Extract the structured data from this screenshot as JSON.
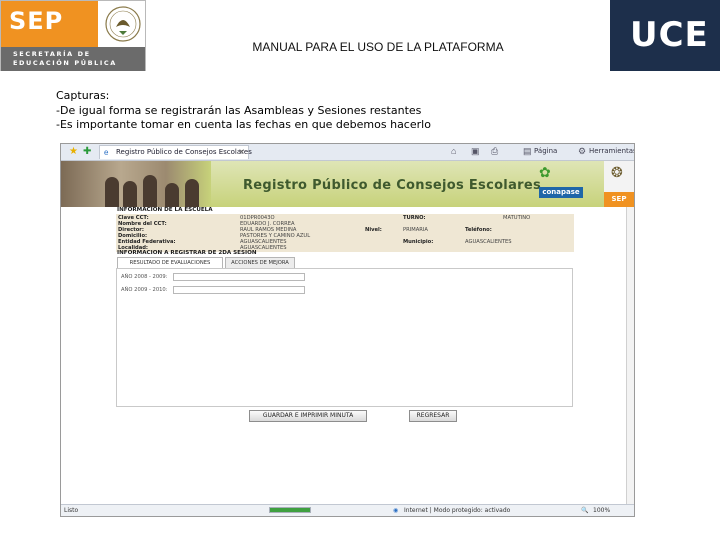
{
  "header": {
    "sep_logo_text": "SEP",
    "sep_subtitle_line1": "SECRETARÍA DE",
    "sep_subtitle_line2": "EDUCACIÓN PÚBLICA",
    "title": "MANUAL PARA EL USO DE LA PLATAFORMA",
    "uce_logo_text": "UCE"
  },
  "caption": {
    "heading": "Capturas:",
    "line1": "-De igual forma se registrarán las  Asambleas y Sesiones restantes",
    "line2": "-Es importante tomar en cuenta las fechas en que debemos hacerlo"
  },
  "browser": {
    "tab_title": "Registro Público de Consejos Escolares",
    "toolbar": {
      "page_menu": "Página",
      "tools_menu": "Herramientas"
    },
    "status": {
      "left": "Listo",
      "zone": "Internet | Modo protegido: activado",
      "zoom": "100%",
      "progress": 1.0
    }
  },
  "site": {
    "banner_title": "Registro Público de Consejos Escolares",
    "conapase_label": "conapase",
    "sep_label": "SEP",
    "school_section": "INFORMACION DE LA ESCUELA",
    "fields": [
      {
        "label": "Clave CCT:",
        "value": "01DPR0043O",
        "label2": "TURNO:",
        "value2": "MATUTINO"
      },
      {
        "label": "Nombre del CCT:",
        "value": "EDUARDO J. CORREA",
        "label2": "",
        "value2": ""
      },
      {
        "label": "Director:",
        "value": "RAUL RAMOS MEDINA",
        "label2": "Nivel:",
        "value2": "PRIMARIA",
        "label3": "Teléfono:",
        "value3": ""
      },
      {
        "label": "Domicilio:",
        "value": "PASTORES Y CAMINO AZUL",
        "label2": "",
        "value2": ""
      },
      {
        "label": "Entidad Federativa:",
        "value": "AGUASCALIENTES",
        "label2": "Municipio:",
        "value2": "AGUASCALIENTES"
      },
      {
        "label": "Localidad:",
        "value": "AGUASCALIENTES",
        "label2": "",
        "value2": ""
      }
    ],
    "session_section": "INFORMACION A REGISTRAR DE 2DA SESION",
    "tabs": [
      "RESULTADO DE EVALUACIONES",
      "ACCIONES DE MEJORA"
    ],
    "year_fields": [
      {
        "label": "AÑO 2008 - 2009:",
        "value": ""
      },
      {
        "label": "AÑO 2009 - 2010:",
        "value": ""
      }
    ],
    "save_button": "GUARDAR E IMPRIMIR MINUTA",
    "back_button": "REGRESAR"
  }
}
